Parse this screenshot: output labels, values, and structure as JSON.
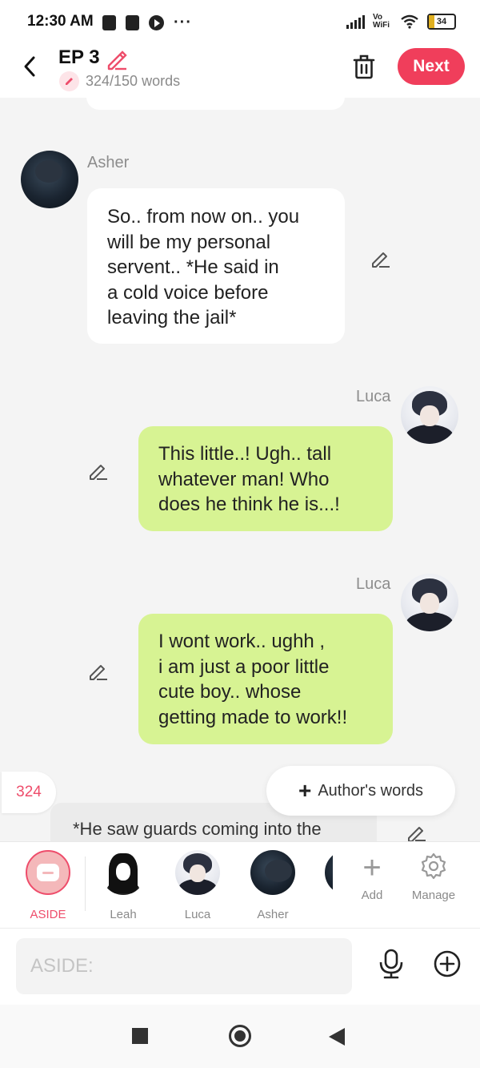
{
  "status_bar": {
    "time": "12:30 AM",
    "network": "Vo WiFi",
    "battery": "34"
  },
  "header": {
    "title": "EP 3",
    "word_count": "324/150 words",
    "next_label": "Next"
  },
  "messages": [
    {
      "sender": "Asher",
      "side": "left",
      "text": "So.. from now on.. you\nwill be my personal\nservent.. *He said in\na cold voice before\nleaving the jail*"
    },
    {
      "sender": "Luca",
      "side": "right",
      "text": "This little..! Ugh.. tall\nwhatever man! Who\ndoes he think he is...!"
    },
    {
      "sender": "Luca",
      "side": "right",
      "text": "I wont work.. ughh ,\ni am just a poor little\ncute boy.. whose\ngetting made to work!!"
    }
  ],
  "count_badge": "324",
  "author_words_label": "Author's words",
  "aside_preview": "*He saw guards coming into the",
  "characters": [
    {
      "name": "ASIDE"
    },
    {
      "name": "Leah"
    },
    {
      "name": "Luca"
    },
    {
      "name": "Asher"
    }
  ],
  "char_actions": {
    "add": "Add",
    "manage": "Manage"
  },
  "input": {
    "placeholder": "ASIDE:"
  },
  "colors": {
    "accent": "#f03e5b",
    "bubble_right": "#d7f393",
    "underline": "#f0922e"
  }
}
